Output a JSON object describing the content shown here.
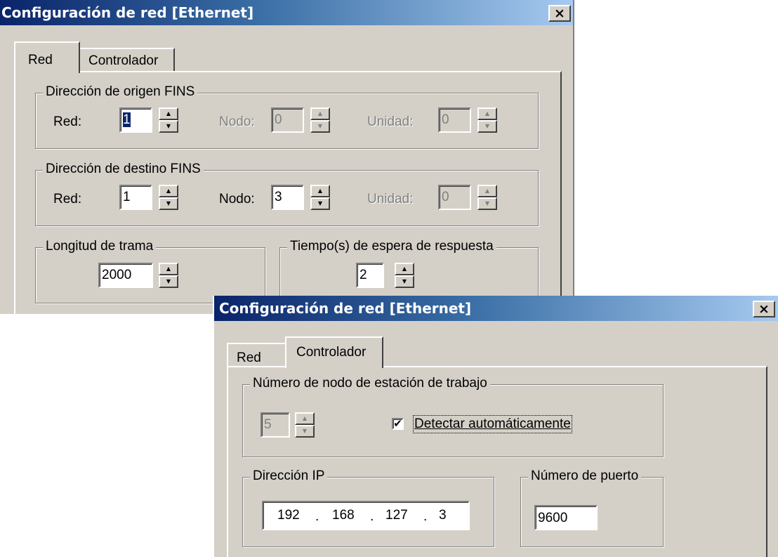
{
  "win1": {
    "title": "Configuración de red [Ethernet]",
    "close": "×",
    "tabs": [
      "Red",
      "Controlador"
    ],
    "origin": {
      "legend": "Dirección de origen FINS",
      "red_label": "Red:",
      "red_value": "1",
      "nodo_label": "Nodo:",
      "nodo_value": "0",
      "unidad_label": "Unidad:",
      "unidad_value": "0"
    },
    "dest": {
      "legend": "Dirección de destino FINS",
      "red_label": "Red:",
      "red_value": "1",
      "nodo_label": "Nodo:",
      "nodo_value": "3",
      "unidad_label": "Unidad:",
      "unidad_value": "0"
    },
    "frame": {
      "legend": "Longitud de trama",
      "value": "2000"
    },
    "timeout": {
      "legend": "Tiempo(s) de espera de respuesta",
      "value": "2"
    }
  },
  "win2": {
    "title": "Configuración de red [Ethernet]",
    "close": "×",
    "tabs": [
      "Red",
      "Controlador"
    ],
    "workstation": {
      "legend": "Número de nodo de estación de trabajo",
      "value": "5",
      "auto_label": "Detectar automáticamente",
      "auto_checked": "✔"
    },
    "ip": {
      "legend": "Dirección IP",
      "oct1": "192",
      "oct2": "168",
      "oct3": "127",
      "oct4": "3",
      "dot": "."
    },
    "port": {
      "legend": "Número de puerto",
      "value": "9600"
    }
  },
  "icons": {
    "spin_up": "▲",
    "spin_down": "▼"
  }
}
